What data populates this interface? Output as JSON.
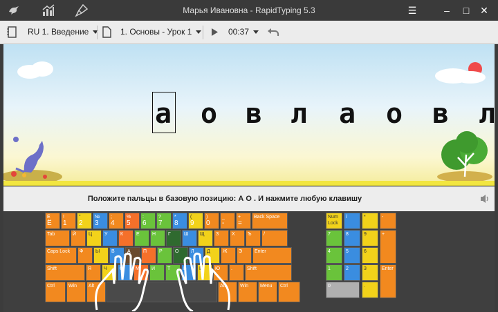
{
  "window": {
    "title": "Марья Ивановна - RapidTyping 5.3",
    "icons": [
      "bird-icon",
      "stats-icon",
      "brush-icon"
    ],
    "buttons": [
      "menu-icon",
      "minimize-icon",
      "maximize-icon",
      "close-icon"
    ]
  },
  "toolbar": {
    "course": "RU 1. Введение",
    "lesson": "1. Основы - Урок 1",
    "time": "00:37"
  },
  "exercise": {
    "letters": [
      "а",
      "о",
      "в",
      "л",
      "а",
      "о",
      "в",
      "л"
    ],
    "hint": "Положите пальцы в базовую позицию:  А  О .  И нажмите любую клавишу"
  },
  "keyboard": {
    "num_row": [
      {
        "t": "Ё",
        "b": "Ё"
      },
      {
        "t": "!",
        "b": "1"
      },
      {
        "t": "\"",
        "b": "2"
      },
      {
        "t": "№",
        "b": "3"
      },
      {
        "t": ";",
        "b": "4"
      },
      {
        "t": "%",
        "b": "5"
      },
      {
        "t": ":",
        "b": "6"
      },
      {
        "t": "?",
        "b": "7"
      },
      {
        "t": "*",
        "b": "8"
      },
      {
        "t": "(",
        "b": "9"
      },
      {
        "t": ")",
        "b": "0"
      },
      {
        "t": "_",
        "b": "-"
      },
      {
        "t": "+",
        "b": "="
      },
      {
        "t": "Back Space",
        "b": ""
      }
    ],
    "q_row": [
      "Tab",
      "Й",
      "Ц",
      "У",
      "К",
      "Е",
      "Н",
      "Г",
      "Ш",
      "Щ",
      "З",
      "Х",
      "Ъ",
      "/"
    ],
    "a_row": [
      "Caps Lock",
      "Ф",
      "Ы",
      "В",
      "А",
      "П",
      "Р",
      "О",
      "Л",
      "Д",
      "Ж",
      "Э",
      "Enter"
    ],
    "z_row": [
      "Shift",
      "Я",
      "Ч",
      "С",
      "М",
      "И",
      "Т",
      "Ь",
      "Б",
      "Ю",
      ".",
      "Shift"
    ],
    "mod_row": [
      "Ctrl",
      "Win",
      "Alt",
      "",
      "Alt",
      "Win",
      "Menu",
      "Ctrl"
    ],
    "numpad": [
      "Num Lock",
      "/",
      "*",
      "-",
      "7",
      "8",
      "9",
      "+",
      "4",
      "5",
      "6",
      "1",
      "2",
      "3",
      "Enter",
      "0",
      "."
    ]
  }
}
